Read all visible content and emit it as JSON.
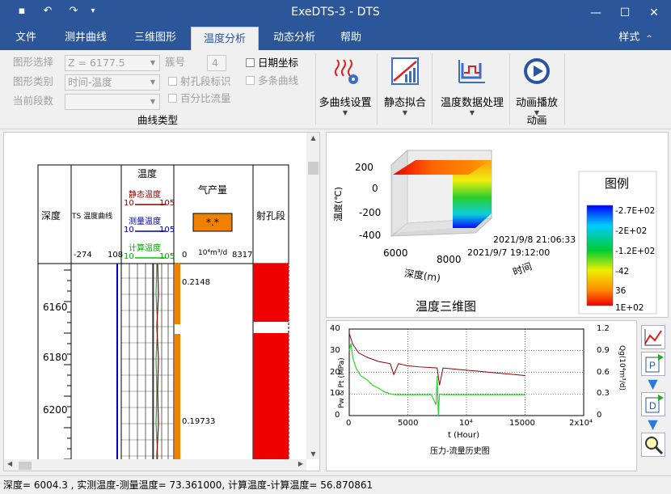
{
  "window": {
    "title": "ExeDTS-3 - DTS"
  },
  "menu": [
    "文件",
    "测井曲线",
    "三维图形",
    "温度分析",
    "动态分析",
    "帮助"
  ],
  "menu_style": "样式",
  "ribbon": {
    "labels": {
      "select": "图形选择",
      "category": "图形类别",
      "seg_count": "当前段数",
      "cluster": "簇号"
    },
    "values": {
      "select": "Z = 6177.5",
      "category": "时间-温度",
      "seg_count": "",
      "cluster": "4"
    },
    "checks": {
      "date_axis": "日期坐标",
      "perf_mark": "射孔段标识",
      "multi_curve": "多条曲线",
      "pct_flow": "百分比流量"
    },
    "group_curve": "曲线类型",
    "buttons": {
      "multi": "多曲线设置",
      "static": "静态拟合",
      "process": "温度数据处理",
      "anim": "动画播放"
    },
    "group_anim": "动画"
  },
  "log": {
    "col_depth": "深度",
    "col_ts": "TS 温度曲线",
    "col_temp": "温度",
    "legend_static": "静态温度",
    "legend_measured": "测量温度",
    "legend_calc": "计算温度",
    "scale_left": "10",
    "scale_right": "105",
    "col_gas": "气产量",
    "gas_box": "*.*",
    "gas_unit": "10⁴m³/d",
    "col_perf": "射孔段",
    "ts_min": "-274",
    "ts_max": "108",
    "gas_min": "0",
    "gas_max": "8317",
    "depths": [
      "6160",
      "6180",
      "6200"
    ],
    "gas_values": [
      "0.2148",
      "0.19733"
    ]
  },
  "chart3d": {
    "title": "温度三维图",
    "zlabel": "温度(℃)",
    "xlabel": "深度(m)",
    "ylabel": "时间",
    "zticks": [
      "200",
      "0",
      "-200",
      "-400"
    ],
    "xticks": [
      "6000",
      "8000"
    ],
    "yticks": [
      "2021/9/8 21:06:33",
      "2021/9/7 19:12:00"
    ],
    "legend_title": "图例",
    "legend_values": [
      "-2.7E+02",
      "-2E+02",
      "-1.2E+02",
      "-42",
      "36",
      "1E+02"
    ]
  },
  "chart_data": {
    "type": "line",
    "title": "压力-流量历史图",
    "xlabel": "t (Hour)",
    "ylabel": "Pw & Pt (MPa)",
    "y2label": "Qg(10⁴m³/d)",
    "xlim": [
      0,
      20000
    ],
    "ylim": [
      0,
      40
    ],
    "y2lim": [
      0,
      1.2
    ],
    "xticks": [
      "0",
      "5000",
      "10⁴",
      "15000",
      "2x10⁴"
    ],
    "yticks": [
      "0",
      "10",
      "20",
      "30",
      "40"
    ],
    "y2ticks": [
      "0",
      "0.3",
      "0.6",
      "0.9",
      "1.2"
    ],
    "series": [
      {
        "x": [
          0,
          300,
          800,
          1500,
          2500,
          3500,
          3800,
          4200,
          5000,
          6000,
          7500,
          7700,
          8000,
          9000,
          10000,
          11000,
          12000,
          13000,
          14000,
          15000
        ],
        "values": [
          38,
          33,
          29,
          27,
          25,
          24,
          19,
          24,
          23,
          22.5,
          22,
          14,
          22,
          21.5,
          21,
          20.5,
          20,
          19.5,
          19,
          18.5
        ]
      },
      {
        "x": [
          0,
          150,
          300,
          600,
          1000,
          1500,
          2000,
          2500,
          3000,
          3500,
          4000,
          5000,
          6000,
          7000,
          7400,
          7500,
          7600,
          7700,
          8000,
          9000,
          10000,
          12000,
          14000,
          15000
        ],
        "values": [
          0.9,
          1.0,
          0.8,
          0.65,
          0.55,
          0.5,
          0.42,
          0.38,
          0.33,
          0.3,
          0.29,
          0.29,
          0.29,
          0.29,
          0.15,
          0.55,
          0.0,
          0.3,
          0.29,
          0.29,
          0.29,
          0.29,
          0.29,
          0.29
        ]
      }
    ]
  },
  "status": "深度= 6004.3 , 实测温度-测量温度= 73.361000, 计算温度-计算温度= 56.870861"
}
